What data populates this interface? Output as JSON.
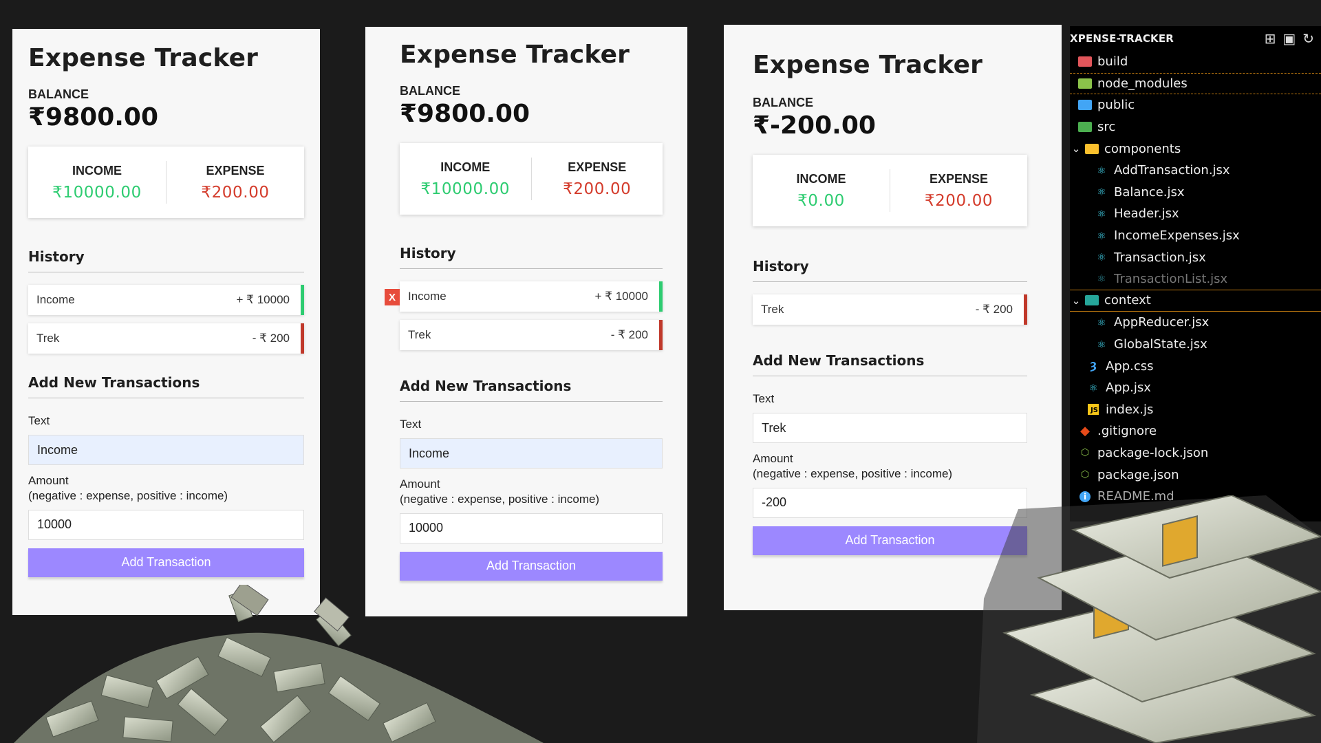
{
  "panels": [
    {
      "title": "Expense Tracker",
      "balance_label": "BALANCE",
      "balance": "₹9800.00",
      "income_label": "INCOME",
      "income": "₹10000.00",
      "expense_label": "EXPENSE",
      "expense": "₹200.00",
      "history_title": "History",
      "transactions": [
        {
          "text": "Income",
          "amount": "+ ₹ 10000",
          "type": "plus"
        },
        {
          "text": "Trek",
          "amount": "- ₹ 200",
          "type": "minus"
        }
      ],
      "add_title": "Add New Transactions",
      "text_label": "Text",
      "text_value": "Income",
      "amount_label": "Amount",
      "amount_hint": "(negative : expense, positive : income)",
      "amount_value": "10000",
      "button": "Add Transaction"
    },
    {
      "title": "Expense Tracker",
      "balance_label": "BALANCE",
      "balance": "₹9800.00",
      "income_label": "INCOME",
      "income": "₹10000.00",
      "expense_label": "EXPENSE",
      "expense": "₹200.00",
      "history_title": "History",
      "delete_label": "X",
      "transactions": [
        {
          "text": "Income",
          "amount": "+ ₹ 10000",
          "type": "plus"
        },
        {
          "text": "Trek",
          "amount": "- ₹ 200",
          "type": "minus"
        }
      ],
      "add_title": "Add New Transactions",
      "text_label": "Text",
      "text_value": "Income",
      "amount_label": "Amount",
      "amount_hint": "(negative : expense, positive : income)",
      "amount_value": "10000",
      "button": "Add Transaction"
    },
    {
      "title": "Expense Tracker",
      "balance_label": "BALANCE",
      "balance": "₹-200.00",
      "income_label": "INCOME",
      "income": "₹0.00",
      "expense_label": "EXPENSE",
      "expense": "₹200.00",
      "history_title": "History",
      "transactions": [
        {
          "text": "Trek",
          "amount": "- ₹ 200",
          "type": "minus"
        }
      ],
      "add_title": "Add New Transactions",
      "text_label": "Text",
      "text_value": "Trek",
      "amount_label": "Amount",
      "amount_hint": "(negative : expense, positive : income)",
      "amount_value": "-200",
      "button": "Add Transaction"
    }
  ],
  "explorer": {
    "title": "XPENSE-TRACKER",
    "items": [
      {
        "label": "build",
        "icon": "folder-icon"
      },
      {
        "label": "node_modules",
        "icon": "folder-icon"
      },
      {
        "label": "public",
        "icon": "folder-icon"
      },
      {
        "label": "src",
        "icon": "folder-icon"
      },
      {
        "label": "components",
        "icon": "folder-open-icon"
      },
      {
        "label": "AddTransaction.jsx",
        "icon": "react-icon"
      },
      {
        "label": "Balance.jsx",
        "icon": "react-icon"
      },
      {
        "label": "Header.jsx",
        "icon": "react-icon"
      },
      {
        "label": "IncomeExpenses.jsx",
        "icon": "react-icon"
      },
      {
        "label": "Transaction.jsx",
        "icon": "react-icon"
      },
      {
        "label": "TransactionList.jsx",
        "icon": "react-icon"
      },
      {
        "label": "context",
        "icon": "folder-open-icon"
      },
      {
        "label": "AppReducer.jsx",
        "icon": "react-icon"
      },
      {
        "label": "GlobalState.jsx",
        "icon": "react-icon"
      },
      {
        "label": "App.css",
        "icon": "css-icon"
      },
      {
        "label": "App.jsx",
        "icon": "react-icon"
      },
      {
        "label": "index.js",
        "icon": "js-icon"
      },
      {
        "label": ".gitignore",
        "icon": "git-icon"
      },
      {
        "label": "package-lock.json",
        "icon": "npm-icon"
      },
      {
        "label": "package.json",
        "icon": "npm-icon"
      },
      {
        "label": "README.md",
        "icon": "info-icon"
      }
    ]
  },
  "colors": {
    "background": "#1b1b1b",
    "panel": "#f7f7f7",
    "income": "#2ecc71",
    "expense": "#c0392b",
    "button": "#9c88ff"
  }
}
